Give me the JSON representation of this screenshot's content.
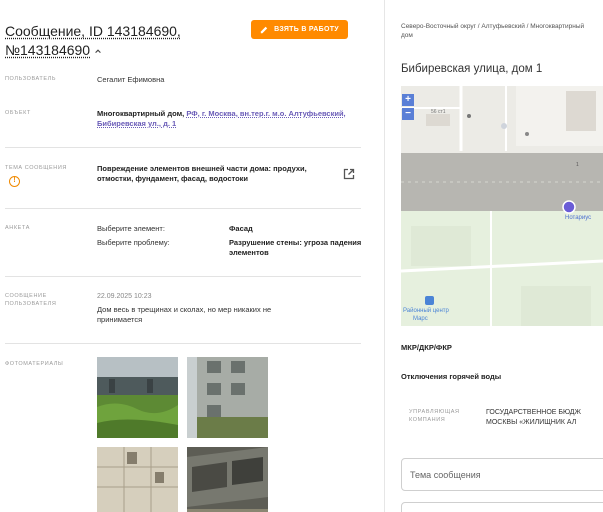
{
  "message": {
    "title_line1": "Сообщение, ID 143184690,",
    "title_line2": "№143184690",
    "take_button": "ВЗЯТЬ В РАБОТУ"
  },
  "fields": {
    "user_label": "ПОЛЬЗОВАТЕЛЬ",
    "user_value": "Сегалит Ефимовна",
    "object_label": "ОБЪЕКТ",
    "object_prefix": "Многоквартирный дом,",
    "object_link": "РФ, г. Москва, вн.тер.г. м.о. Алтуфьевский, Бибиревская ул., д. 1",
    "topic_label": "ТЕМА СООБЩЕНИЯ",
    "topic_value": "Повреждение элементов внешней части дома: продухи, отмостки, фундамент, фасад, водостоки",
    "survey_label": "АНКЕТА",
    "survey_q1": "Выберите элемент:",
    "survey_a1": "Фасад",
    "survey_q2": "Выберите проблему:",
    "survey_a2": "Разрушение стены: угроза падения элементов",
    "msg_label": "СООБЩЕНИЕ ПОЛЬЗОВАТЕЛЯ",
    "msg_date": "22.09.2025 10:23",
    "msg_text": "Дом весь в трещинах и сколах, но мер никаких не принимается",
    "photos_label": "ФОТОМАТЕРИАЛЫ"
  },
  "right": {
    "breadcrumbs": "Северо-Восточный округ / Алтуфьевский / Многоквартирный дом",
    "address": "Бибиревская улица, дом 1",
    "map": {
      "zoom_in": "+",
      "zoom_out": "−",
      "label_house": "56 ст1",
      "label_num": "1",
      "label_notary": "Нотариус",
      "label_center": "Районный центр",
      "label_mars": "Марс",
      "accent": "#6a5cd6"
    },
    "mkr": "МКР/ДКР/ФКР",
    "hot_water": "Отключения горячей воды",
    "mgmt_label": "УПРАВЛЯЮЩАЯ КОМПАНИЯ",
    "mgmt_value_line1": "ГОСУДАРСТВЕННОЕ БЮДЖ",
    "mgmt_value_line2": "МОСКВЫ «ЖИЛИЩНИК АЛ",
    "topic_placeholder": "Тема сообщения"
  },
  "colors": {
    "accent_orange": "#ff8a00",
    "link_purple": "#6a5cb8",
    "map_button": "#5a7fd6"
  }
}
